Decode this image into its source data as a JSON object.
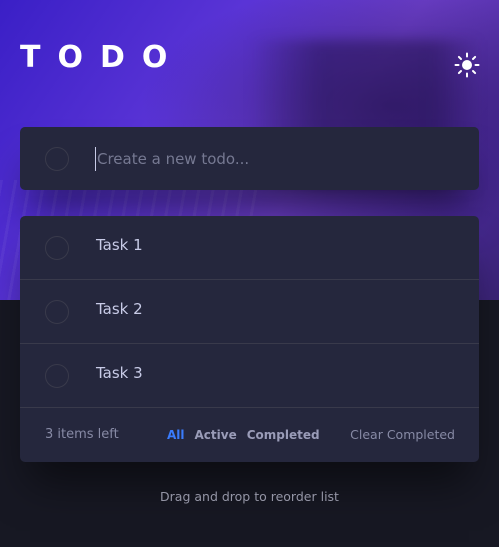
{
  "header": {
    "title": "TODO",
    "theme_icon": "sun-icon"
  },
  "new_todo": {
    "placeholder": "Create a new todo..."
  },
  "todos": [
    {
      "label": "Task 1",
      "completed": false
    },
    {
      "label": "Task 2",
      "completed": false
    },
    {
      "label": "Task 3",
      "completed": false
    }
  ],
  "footer": {
    "items_left": "3 items left",
    "filters": {
      "all": "All",
      "active": "Active",
      "completed": "Completed"
    },
    "selected_filter": "All",
    "clear": "Clear Completed"
  },
  "hint": "Drag and drop to reorder list",
  "colors": {
    "accent": "#3a7cfd",
    "card_bg": "#25273d",
    "page_bg": "#171823",
    "hero_from": "#3a1fc6",
    "hero_to": "#6b3ec8"
  }
}
